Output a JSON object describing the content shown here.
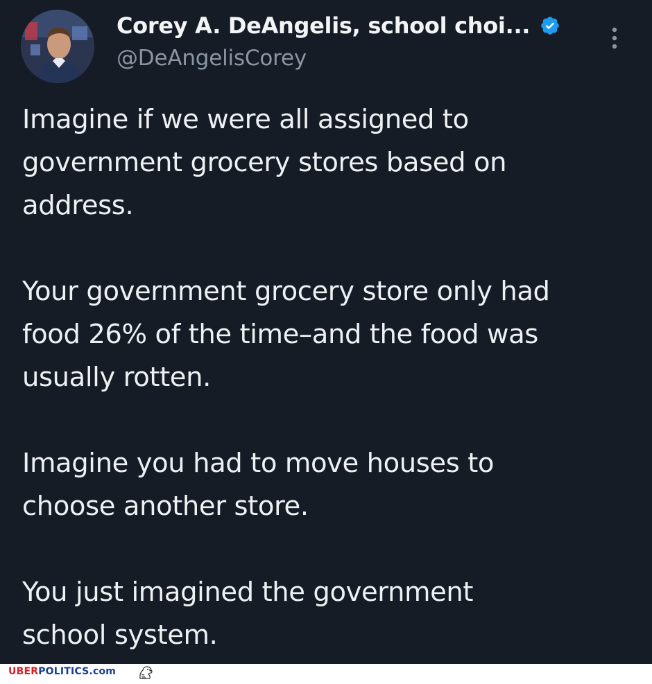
{
  "author": {
    "display_name": "Corey A. DeAngelis, school choi...",
    "handle": "@DeAngelisCorey",
    "verified": true,
    "verified_color": "#1d9bf0"
  },
  "icons": {
    "verified": "verified-badge-icon",
    "more": "more-vertical-icon",
    "watermark_logo": "eagle-icon"
  },
  "tweet": {
    "paragraphs": [
      "Imagine if we were all assigned to\ngovernment grocery stores based on\naddress.",
      "Your government grocery store only had\nfood 26% of the time–and the food was\nusually rotten.",
      "Imagine you had to move houses to\nchoose another store.",
      "You just imagined the government\nschool system."
    ]
  },
  "watermark": {
    "part1": "UBER",
    "part2": "POLITICS",
    "part3": ".com",
    "color_red": "#d32027",
    "color_blue": "#1a3f8c"
  },
  "colors": {
    "background": "#161c25",
    "text": "#eef1f4",
    "muted": "#8a96a4"
  }
}
